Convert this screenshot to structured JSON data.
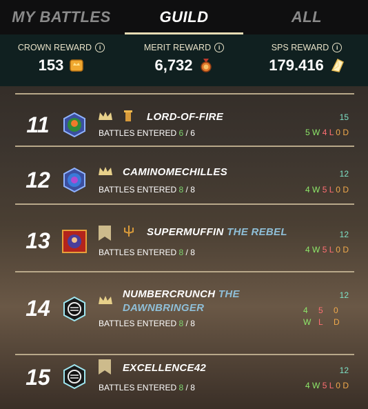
{
  "tabs": [
    {
      "label": "MY BATTLES",
      "active": false
    },
    {
      "label": "GUILD",
      "active": true
    },
    {
      "label": "ALL",
      "active": false
    }
  ],
  "rewards": [
    {
      "label": "CROWN REWARD",
      "value": "153",
      "icon": "crown-chest-icon"
    },
    {
      "label": "MERIT REWARD",
      "value": "6,732",
      "icon": "merit-medal-icon"
    },
    {
      "label": "SPS REWARD",
      "value": "179.416",
      "icon": "sps-crystal-icon"
    }
  ],
  "rows": [
    {
      "rank": "11",
      "name": "LORD-OF-FIRE",
      "title": "",
      "badge": "crown-icon",
      "role": "tower-icon",
      "battles_label": "BATTLES ENTERED",
      "entered": "6",
      "total": "6",
      "count": "15",
      "w": "5",
      "l": "4",
      "d": "0"
    },
    {
      "rank": "12",
      "name": "CAMINOMECHILLES",
      "title": "",
      "badge": "crown-icon",
      "role": "",
      "battles_label": "BATTLES ENTERED",
      "entered": "8",
      "total": "8",
      "count": "12",
      "w": "4",
      "l": "5",
      "d": "0"
    },
    {
      "rank": "13",
      "name": "SUPERMUFFIN",
      "title": "THE REBEL",
      "badge": "banner-icon",
      "role": "trident-icon",
      "battles_label": "BATTLES ENTERED",
      "entered": "8",
      "total": "8",
      "count": "12",
      "w": "4",
      "l": "5",
      "d": "0"
    },
    {
      "rank": "14",
      "name": "NUMBERCRUNCH",
      "title": "THE DAWNBRINGER",
      "badge": "crown-icon",
      "role": "",
      "battles_label": "BATTLES ENTERED",
      "entered": "8",
      "total": "8",
      "count": "12",
      "w": "4",
      "l": "5",
      "d": "0"
    },
    {
      "rank": "15",
      "name": "EXCELLENCE42",
      "title": "",
      "badge": "banner-icon",
      "role": "",
      "battles_label": "BATTLES ENTERED",
      "entered": "8",
      "total": "8",
      "count": "12",
      "w": "4",
      "l": "5",
      "d": "0"
    }
  ],
  "wld_letters": {
    "w": "W",
    "l": "L",
    "d": "D"
  },
  "colors": {
    "accent": "#e7dcb4",
    "win": "#8ee86a",
    "loss": "#ff6f73",
    "draw": "#f0a94c",
    "title": "#8fbfd8",
    "count": "#7fe3c8"
  }
}
